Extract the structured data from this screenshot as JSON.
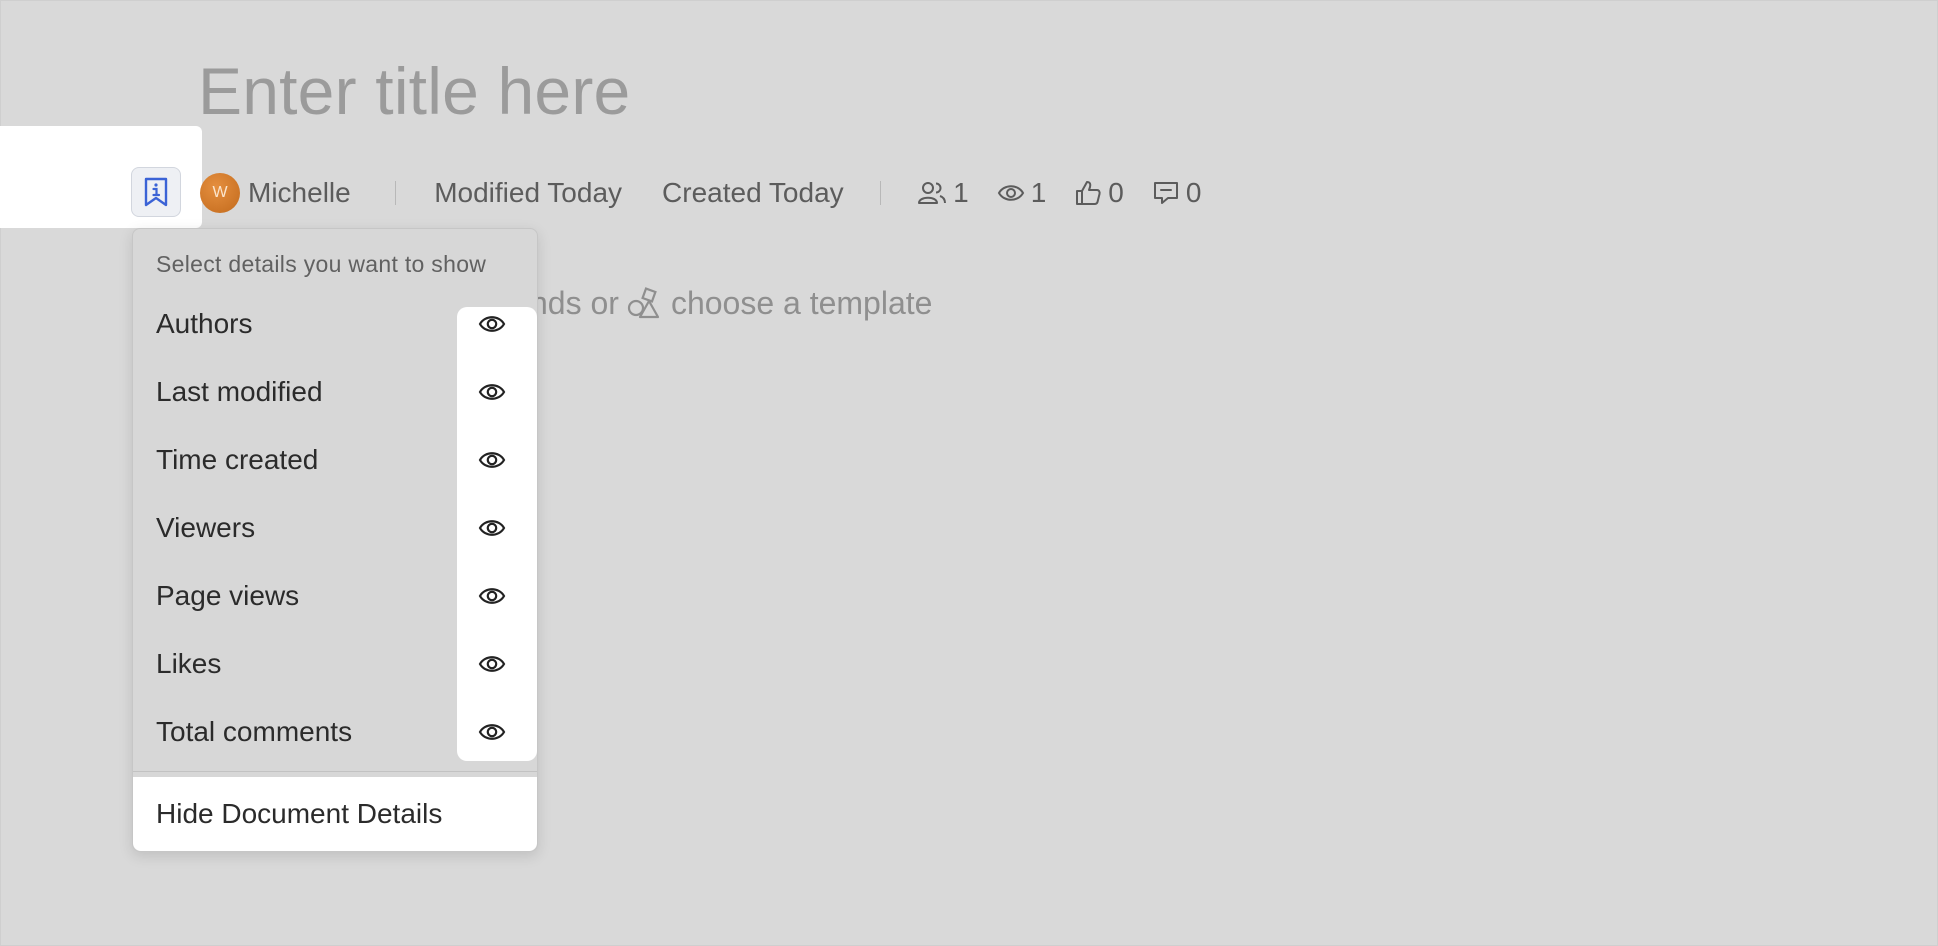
{
  "document": {
    "title_placeholder": "Enter title here",
    "editor_placeholder_end": "nds or",
    "editor_placeholder_link": "choose a template"
  },
  "meta": {
    "author_initial": "W",
    "author_name": "Michelle",
    "modified": "Modified Today",
    "created": "Created Today",
    "viewers_count": "1",
    "page_views_count": "1",
    "likes_count": "0",
    "comments_count": "0"
  },
  "details_menu": {
    "header": "Select details you want to show",
    "items": [
      {
        "label": "Authors",
        "icon": "eye-icon",
        "visible": true
      },
      {
        "label": "Last modified",
        "icon": "eye-icon",
        "visible": true
      },
      {
        "label": "Time created",
        "icon": "eye-icon",
        "visible": true
      },
      {
        "label": "Viewers",
        "icon": "eye-icon",
        "visible": true
      },
      {
        "label": "Page views",
        "icon": "eye-icon",
        "visible": true
      },
      {
        "label": "Likes",
        "icon": "eye-icon",
        "visible": true
      },
      {
        "label": "Total comments",
        "icon": "eye-icon",
        "visible": true
      }
    ],
    "hide_label": "Hide Document Details"
  },
  "colors": {
    "overlay_background": "#d9d9d9",
    "accent_blue": "#3b63d6",
    "avatar_orange": "#d0772a"
  }
}
